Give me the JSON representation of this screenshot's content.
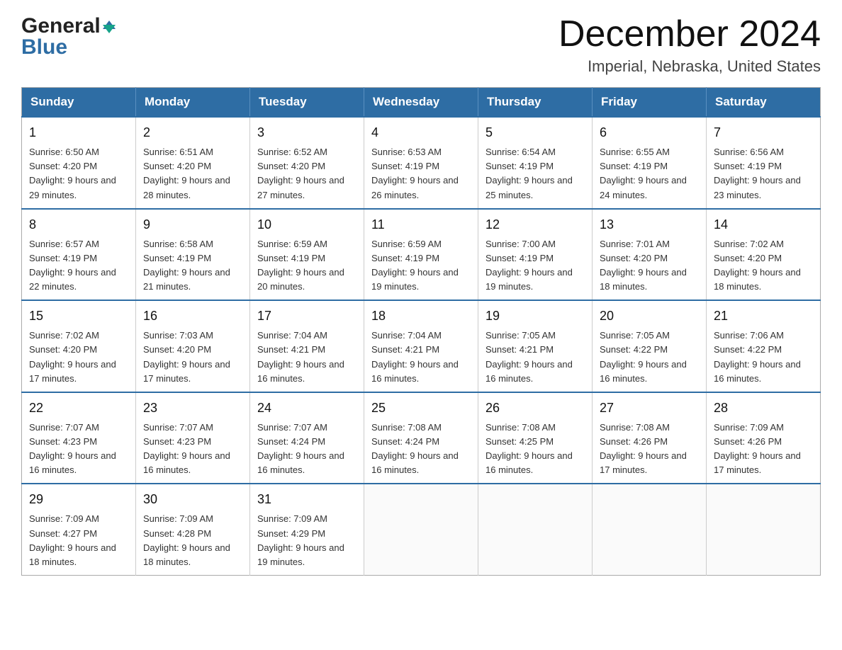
{
  "header": {
    "logo_general": "General",
    "logo_blue": "Blue",
    "month_title": "December 2024",
    "subtitle": "Imperial, Nebraska, United States"
  },
  "days_of_week": [
    "Sunday",
    "Monday",
    "Tuesday",
    "Wednesday",
    "Thursday",
    "Friday",
    "Saturday"
  ],
  "weeks": [
    [
      {
        "day": "1",
        "sunrise": "Sunrise: 6:50 AM",
        "sunset": "Sunset: 4:20 PM",
        "daylight": "Daylight: 9 hours and 29 minutes."
      },
      {
        "day": "2",
        "sunrise": "Sunrise: 6:51 AM",
        "sunset": "Sunset: 4:20 PM",
        "daylight": "Daylight: 9 hours and 28 minutes."
      },
      {
        "day": "3",
        "sunrise": "Sunrise: 6:52 AM",
        "sunset": "Sunset: 4:20 PM",
        "daylight": "Daylight: 9 hours and 27 minutes."
      },
      {
        "day": "4",
        "sunrise": "Sunrise: 6:53 AM",
        "sunset": "Sunset: 4:19 PM",
        "daylight": "Daylight: 9 hours and 26 minutes."
      },
      {
        "day": "5",
        "sunrise": "Sunrise: 6:54 AM",
        "sunset": "Sunset: 4:19 PM",
        "daylight": "Daylight: 9 hours and 25 minutes."
      },
      {
        "day": "6",
        "sunrise": "Sunrise: 6:55 AM",
        "sunset": "Sunset: 4:19 PM",
        "daylight": "Daylight: 9 hours and 24 minutes."
      },
      {
        "day": "7",
        "sunrise": "Sunrise: 6:56 AM",
        "sunset": "Sunset: 4:19 PM",
        "daylight": "Daylight: 9 hours and 23 minutes."
      }
    ],
    [
      {
        "day": "8",
        "sunrise": "Sunrise: 6:57 AM",
        "sunset": "Sunset: 4:19 PM",
        "daylight": "Daylight: 9 hours and 22 minutes."
      },
      {
        "day": "9",
        "sunrise": "Sunrise: 6:58 AM",
        "sunset": "Sunset: 4:19 PM",
        "daylight": "Daylight: 9 hours and 21 minutes."
      },
      {
        "day": "10",
        "sunrise": "Sunrise: 6:59 AM",
        "sunset": "Sunset: 4:19 PM",
        "daylight": "Daylight: 9 hours and 20 minutes."
      },
      {
        "day": "11",
        "sunrise": "Sunrise: 6:59 AM",
        "sunset": "Sunset: 4:19 PM",
        "daylight": "Daylight: 9 hours and 19 minutes."
      },
      {
        "day": "12",
        "sunrise": "Sunrise: 7:00 AM",
        "sunset": "Sunset: 4:19 PM",
        "daylight": "Daylight: 9 hours and 19 minutes."
      },
      {
        "day": "13",
        "sunrise": "Sunrise: 7:01 AM",
        "sunset": "Sunset: 4:20 PM",
        "daylight": "Daylight: 9 hours and 18 minutes."
      },
      {
        "day": "14",
        "sunrise": "Sunrise: 7:02 AM",
        "sunset": "Sunset: 4:20 PM",
        "daylight": "Daylight: 9 hours and 18 minutes."
      }
    ],
    [
      {
        "day": "15",
        "sunrise": "Sunrise: 7:02 AM",
        "sunset": "Sunset: 4:20 PM",
        "daylight": "Daylight: 9 hours and 17 minutes."
      },
      {
        "day": "16",
        "sunrise": "Sunrise: 7:03 AM",
        "sunset": "Sunset: 4:20 PM",
        "daylight": "Daylight: 9 hours and 17 minutes."
      },
      {
        "day": "17",
        "sunrise": "Sunrise: 7:04 AM",
        "sunset": "Sunset: 4:21 PM",
        "daylight": "Daylight: 9 hours and 16 minutes."
      },
      {
        "day": "18",
        "sunrise": "Sunrise: 7:04 AM",
        "sunset": "Sunset: 4:21 PM",
        "daylight": "Daylight: 9 hours and 16 minutes."
      },
      {
        "day": "19",
        "sunrise": "Sunrise: 7:05 AM",
        "sunset": "Sunset: 4:21 PM",
        "daylight": "Daylight: 9 hours and 16 minutes."
      },
      {
        "day": "20",
        "sunrise": "Sunrise: 7:05 AM",
        "sunset": "Sunset: 4:22 PM",
        "daylight": "Daylight: 9 hours and 16 minutes."
      },
      {
        "day": "21",
        "sunrise": "Sunrise: 7:06 AM",
        "sunset": "Sunset: 4:22 PM",
        "daylight": "Daylight: 9 hours and 16 minutes."
      }
    ],
    [
      {
        "day": "22",
        "sunrise": "Sunrise: 7:07 AM",
        "sunset": "Sunset: 4:23 PM",
        "daylight": "Daylight: 9 hours and 16 minutes."
      },
      {
        "day": "23",
        "sunrise": "Sunrise: 7:07 AM",
        "sunset": "Sunset: 4:23 PM",
        "daylight": "Daylight: 9 hours and 16 minutes."
      },
      {
        "day": "24",
        "sunrise": "Sunrise: 7:07 AM",
        "sunset": "Sunset: 4:24 PM",
        "daylight": "Daylight: 9 hours and 16 minutes."
      },
      {
        "day": "25",
        "sunrise": "Sunrise: 7:08 AM",
        "sunset": "Sunset: 4:24 PM",
        "daylight": "Daylight: 9 hours and 16 minutes."
      },
      {
        "day": "26",
        "sunrise": "Sunrise: 7:08 AM",
        "sunset": "Sunset: 4:25 PM",
        "daylight": "Daylight: 9 hours and 16 minutes."
      },
      {
        "day": "27",
        "sunrise": "Sunrise: 7:08 AM",
        "sunset": "Sunset: 4:26 PM",
        "daylight": "Daylight: 9 hours and 17 minutes."
      },
      {
        "day": "28",
        "sunrise": "Sunrise: 7:09 AM",
        "sunset": "Sunset: 4:26 PM",
        "daylight": "Daylight: 9 hours and 17 minutes."
      }
    ],
    [
      {
        "day": "29",
        "sunrise": "Sunrise: 7:09 AM",
        "sunset": "Sunset: 4:27 PM",
        "daylight": "Daylight: 9 hours and 18 minutes."
      },
      {
        "day": "30",
        "sunrise": "Sunrise: 7:09 AM",
        "sunset": "Sunset: 4:28 PM",
        "daylight": "Daylight: 9 hours and 18 minutes."
      },
      {
        "day": "31",
        "sunrise": "Sunrise: 7:09 AM",
        "sunset": "Sunset: 4:29 PM",
        "daylight": "Daylight: 9 hours and 19 minutes."
      },
      null,
      null,
      null,
      null
    ]
  ]
}
